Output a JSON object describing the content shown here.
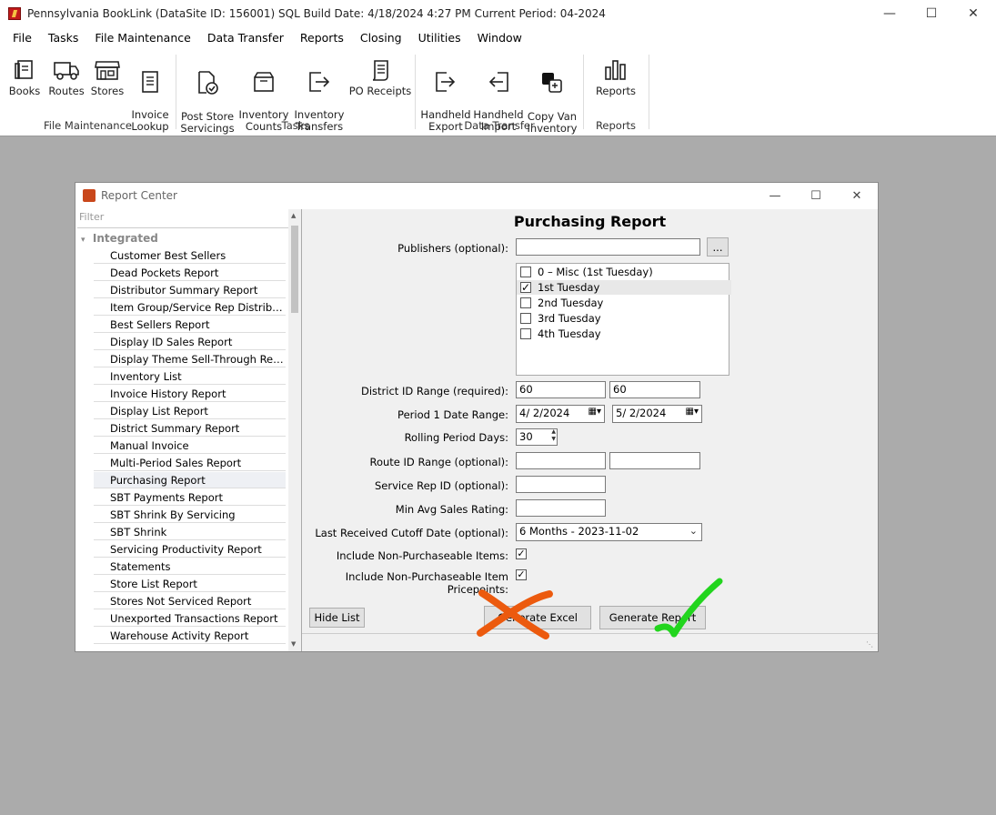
{
  "app": {
    "title": "Pennsylvania BookLink (DataSite ID: 156001) SQL   Build Date: 4/18/2024 4:27 PM   Current Period: 04-2024"
  },
  "menu": [
    "File",
    "Tasks",
    "File Maintenance",
    "Data Transfer",
    "Reports",
    "Closing",
    "Utilities",
    "Window"
  ],
  "ribbon": {
    "file_maintenance": {
      "label": "File Maintenance",
      "buttons": [
        "Books",
        "Routes",
        "Stores",
        "Invoice\nLookup"
      ]
    },
    "tasks": {
      "label": "Tasks",
      "buttons": [
        "Post Store\nServicings",
        "Inventory\nCounts",
        "Inventory\nTransfers",
        "PO Receipts"
      ]
    },
    "data_transfer": {
      "label": "Data Transfer",
      "buttons": [
        "Handheld\nExport",
        "Handheld\nImport",
        "Copy Van\nInventory"
      ]
    },
    "reports": {
      "label": "Reports",
      "buttons": [
        "Reports"
      ]
    }
  },
  "report_center": {
    "title": "Report Center",
    "filter_placeholder": "Filter",
    "group": "Integrated",
    "items": [
      "Customer Best Sellers",
      "Dead Pockets Report",
      "Distributor Summary Report",
      "Item Group/Service Rep Distribution Report",
      "Best Sellers Report",
      "Display ID Sales Report",
      "Display Theme Sell-Through Report",
      "Inventory List",
      "Invoice History Report",
      "Display List Report",
      "District Summary Report",
      "Manual Invoice",
      "Multi-Period Sales Report",
      "Purchasing Report",
      "SBT Payments Report",
      "SBT Shrink By Servicing",
      "SBT Shrink",
      "Servicing Productivity Report",
      "Statements",
      "Store List Report",
      "Stores Not Serviced Report",
      "Unexported Transactions Report",
      "Warehouse Activity Report"
    ],
    "selected_item": "Purchasing Report"
  },
  "form": {
    "heading": "Purchasing Report",
    "publishers_label": "Publishers (optional):",
    "publishers_value": "",
    "browse_label": "...",
    "period_options": [
      {
        "label": "0 – Misc (1st Tuesday)",
        "checked": false
      },
      {
        "label": "1st Tuesday",
        "checked": true
      },
      {
        "label": "2nd Tuesday",
        "checked": false
      },
      {
        "label": "3rd Tuesday",
        "checked": false
      },
      {
        "label": "4th Tuesday",
        "checked": false
      }
    ],
    "district_label": "District ID Range (required):",
    "district_from": "60",
    "district_to": "60",
    "period_label": "Period 1 Date Range:",
    "period_from": "4/  2/2024",
    "period_to": "5/  2/2024",
    "rolling_label": "Rolling Period Days:",
    "rolling_value": "30",
    "route_label": "Route ID Range (optional):",
    "route_from": "",
    "route_to": "",
    "service_rep_label": "Service Rep ID (optional):",
    "service_rep_value": "",
    "min_avg_label": "Min Avg Sales Rating:",
    "min_avg_value": "",
    "cutoff_label": "Last Received Cutoff Date (optional):",
    "cutoff_value": "6 Months - 2023-11-02",
    "non_purch_label": "Include Non-Purchaseable Items:",
    "non_purch_checked": true,
    "non_purch_price_label": "Include Non-Purchaseable Item Pricepoints:",
    "non_purch_price_checked": true,
    "hide_list_label": "Hide List",
    "generate_excel_label": "Generate Excel",
    "generate_report_label": "Generate Report"
  },
  "annotations": {
    "x_mark_color": "#ec5a0e",
    "check_mark_color": "#22d51e"
  }
}
